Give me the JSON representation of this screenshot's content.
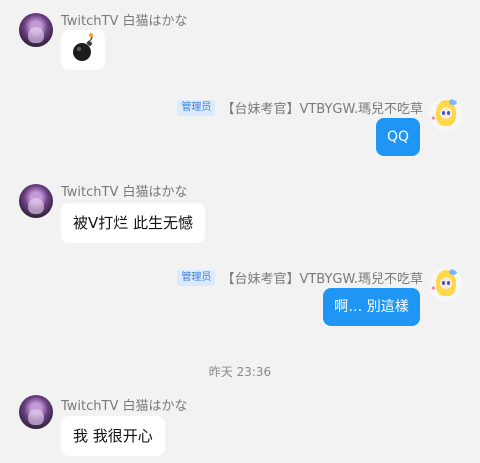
{
  "messages": [
    {
      "sender": "TwitchTV 白猫はかな",
      "emoji_icon": "bomb-icon"
    },
    {
      "admin_badge": "管理员",
      "sender": "【台妹考官】VTBYGW.瑪兒不吃草",
      "text": "QQ"
    },
    {
      "sender": "TwitchTV 白猫はかな",
      "text": "被V打烂 此生无憾"
    },
    {
      "admin_badge": "管理员",
      "sender": "【台妹考官】VTBYGW.瑪兒不吃草",
      "text": "啊… 別這樣"
    },
    {
      "timestamp": "昨天 23:36"
    },
    {
      "sender": "TwitchTV 白猫はかな",
      "text": "我 我很开心"
    }
  ],
  "colors": {
    "own_bubble": "#1f96f3",
    "background": "#f2f2f2",
    "admin_badge_bg": "#dbeafe"
  }
}
